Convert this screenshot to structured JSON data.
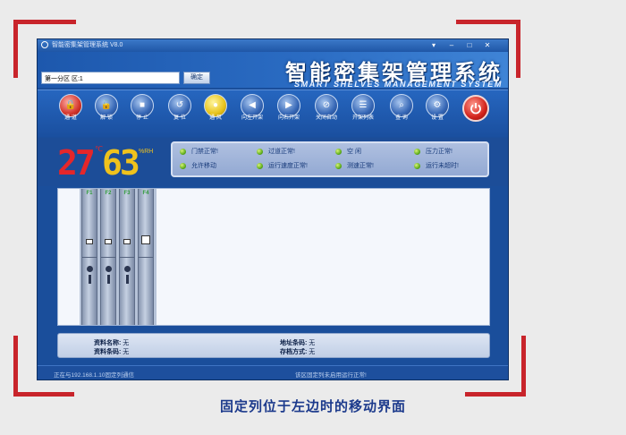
{
  "window": {
    "title": "智能密集架管理系统 V8.0",
    "controls": [
      "▾",
      "–",
      "□",
      "✕"
    ]
  },
  "header": {
    "logo_cn": "智能密集架管理系统",
    "logo_en": "SMART SHELVES MANAGEMENT SYSTEM",
    "zone_value": "第一分区 区:1",
    "zone_button": "确定"
  },
  "toolbar": {
    "buttons": [
      {
        "label": "通 道",
        "icon": "lock-icon"
      },
      {
        "label": "解 锁",
        "icon": "unlock-icon"
      },
      {
        "label": "停 止",
        "icon": "stop-icon"
      },
      {
        "label": "复 位",
        "icon": "reset-icon"
      },
      {
        "label": "通 风",
        "icon": "fan-icon"
      },
      {
        "label": "向左开架",
        "icon": "move-left-icon"
      },
      {
        "label": "向右开架",
        "icon": "move-right-icon"
      },
      {
        "label": "关闭自动",
        "icon": "close-auto-icon"
      },
      {
        "label": "开架列表",
        "icon": "list-icon"
      },
      {
        "label": "查 询",
        "icon": "search-icon"
      },
      {
        "label": "设 置",
        "icon": "settings-icon"
      }
    ],
    "power": "power-icon"
  },
  "readings": {
    "temperature": "27",
    "temp_unit": "℃",
    "humidity": "63",
    "humid_unit": "%RH"
  },
  "status": {
    "items": [
      "门禁正常!",
      "过道正常!",
      "空 闲",
      "压力正常!",
      "允许移动",
      "运行速度正常!",
      "测速正常!",
      "运行未超时!"
    ]
  },
  "shelves": [
    "F1",
    "F2",
    "F3",
    "F4"
  ],
  "info": {
    "name_label": "资料名称:",
    "name_value": "无",
    "barcode_label": "资料条码:",
    "barcode_value": "无",
    "location_label": "地址条码:",
    "location_value": "无",
    "storage_label": "存档方式:",
    "storage_value": "无"
  },
  "statusbar": {
    "left": "正在与192.168.1.10固定列通信",
    "right": "该区固定列未启用运行正常!"
  },
  "caption": "固定列位于左边时的移动界面",
  "colors": {
    "corner": "#c8242b",
    "window": "#1a4e9b",
    "temperature": "#e5262a",
    "humidity": "#f0c21c",
    "status_led": "#5fae1c",
    "caption": "#1c3a8c"
  }
}
